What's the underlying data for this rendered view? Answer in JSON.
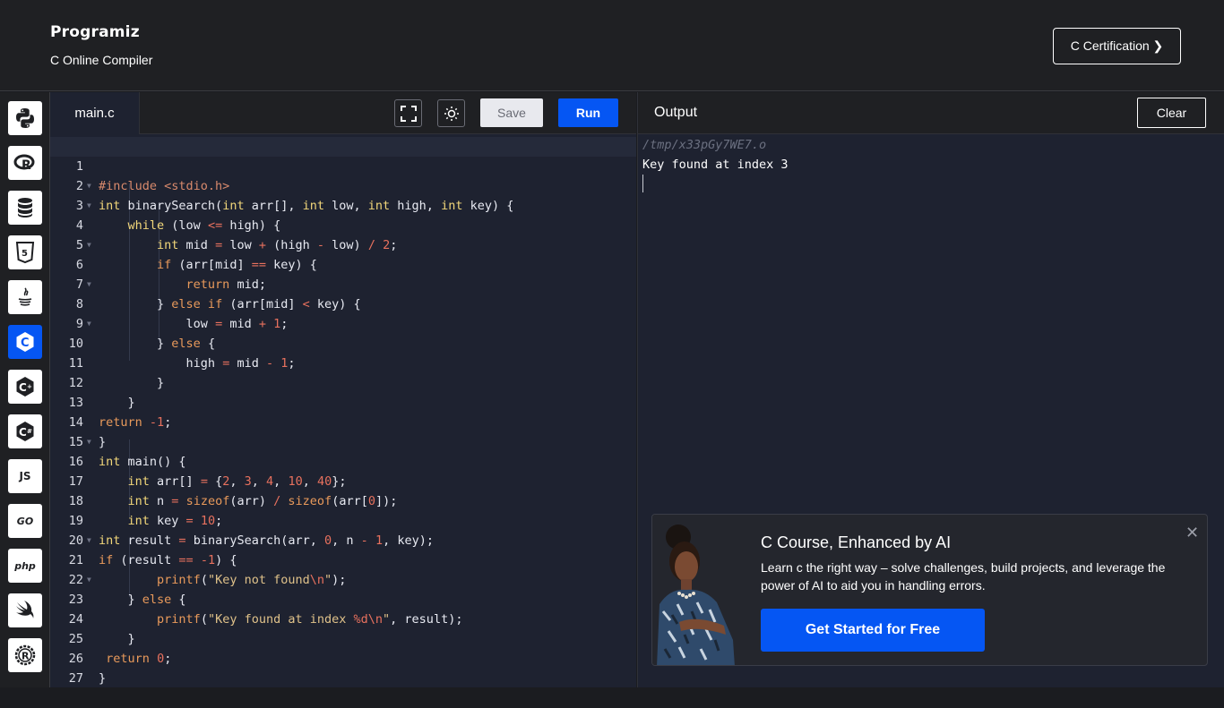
{
  "header": {
    "logo_text": "Programiz",
    "subtitle": "C Online Compiler",
    "cert_button": "C Certification ❯"
  },
  "sidebar": {
    "items": [
      {
        "name": "python",
        "label": ""
      },
      {
        "name": "r",
        "label": "R"
      },
      {
        "name": "sql",
        "label": ""
      },
      {
        "name": "html",
        "label": "5"
      },
      {
        "name": "java",
        "label": ""
      },
      {
        "name": "c",
        "label": "C",
        "active": true
      },
      {
        "name": "cpp",
        "label": "C"
      },
      {
        "name": "csharp",
        "label": "C"
      },
      {
        "name": "js",
        "label": "JS"
      },
      {
        "name": "go",
        "label": "GO"
      },
      {
        "name": "php",
        "label": "php"
      },
      {
        "name": "swift",
        "label": ""
      },
      {
        "name": "rust",
        "label": "R"
      }
    ]
  },
  "editor": {
    "file_tab": "main.c",
    "save_label": "Save",
    "run_label": "Run",
    "lines": [
      {
        "n": "1",
        "fold": false
      },
      {
        "n": "2",
        "fold": true
      },
      {
        "n": "3",
        "fold": true
      },
      {
        "n": "4",
        "fold": false
      },
      {
        "n": "5",
        "fold": true
      },
      {
        "n": "6",
        "fold": false
      },
      {
        "n": "7",
        "fold": true
      },
      {
        "n": "8",
        "fold": false
      },
      {
        "n": "9",
        "fold": true
      },
      {
        "n": "10",
        "fold": false
      },
      {
        "n": "11",
        "fold": false
      },
      {
        "n": "12",
        "fold": false
      },
      {
        "n": "13",
        "fold": false
      },
      {
        "n": "14",
        "fold": false
      },
      {
        "n": "15",
        "fold": true
      },
      {
        "n": "16",
        "fold": false
      },
      {
        "n": "17",
        "fold": false
      },
      {
        "n": "18",
        "fold": false
      },
      {
        "n": "19",
        "fold": false
      },
      {
        "n": "20",
        "fold": true
      },
      {
        "n": "21",
        "fold": false
      },
      {
        "n": "22",
        "fold": true
      },
      {
        "n": "23",
        "fold": false
      },
      {
        "n": "24",
        "fold": false
      },
      {
        "n": "25",
        "fold": false
      },
      {
        "n": "26",
        "fold": false
      },
      {
        "n": "27",
        "fold": false
      }
    ],
    "code": {
      "l1_a": "#include ",
      "l1_b": "<stdio.h>",
      "l2_a": "int",
      "l2_b": " binarySearch(",
      "l2_c": "int",
      "l2_d": " arr[], ",
      "l2_e": "int",
      "l2_f": " low, ",
      "l2_g": "int",
      "l2_h": " high, ",
      "l2_i": "int",
      "l2_j": " key) {",
      "l3_a": "while",
      "l3_b": " (low ",
      "l3_c": "<=",
      "l3_d": " high) {",
      "l4_a": "int",
      "l4_b": " mid ",
      "l4_c": "=",
      "l4_d": " low ",
      "l4_e": "+",
      "l4_f": " (high ",
      "l4_g": "-",
      "l4_h": " low) ",
      "l4_i": "/",
      "l4_j": " ",
      "l4_k": "2",
      "l4_l": ";",
      "l5_a": "if",
      "l5_b": " (arr[mid] ",
      "l5_c": "==",
      "l5_d": " key) {",
      "l6_a": "return",
      "l6_b": " mid;",
      "l7_a": "} ",
      "l7_b": "else if",
      "l7_c": " (arr[mid] ",
      "l7_d": "<",
      "l7_e": " key) {",
      "l8_a": "low ",
      "l8_b": "=",
      "l8_c": " mid ",
      "l8_d": "+",
      "l8_e": " ",
      "l8_f": "1",
      "l8_g": ";",
      "l9_a": "} ",
      "l9_b": "else",
      "l9_c": " {",
      "l10_a": "high ",
      "l10_b": "=",
      "l10_c": " mid ",
      "l10_d": "-",
      "l10_e": " ",
      "l10_f": "1",
      "l10_g": ";",
      "l11": "}",
      "l12": "}",
      "l13_a": "return",
      "l13_b": " ",
      "l13_c": "-1",
      "l13_d": ";",
      "l14": "}",
      "l15_a": "int",
      "l15_b": " main() {",
      "l16_a": "int",
      "l16_b": " arr[] ",
      "l16_c": "=",
      "l16_d": " {",
      "l16_e": "2",
      "l16_f": ", ",
      "l16_g": "3",
      "l16_h": ", ",
      "l16_i": "4",
      "l16_j": ", ",
      "l16_k": "10",
      "l16_l": ", ",
      "l16_m": "40",
      "l16_n": "};",
      "l17_a": "int",
      "l17_b": " n ",
      "l17_c": "=",
      "l17_d": " ",
      "l17_e": "sizeof",
      "l17_f": "(arr) ",
      "l17_g": "/",
      "l17_h": " ",
      "l17_i": "sizeof",
      "l17_j": "(arr[",
      "l17_k": "0",
      "l17_l": "]);",
      "l18_a": "int",
      "l18_b": " key ",
      "l18_c": "=",
      "l18_d": " ",
      "l18_e": "10",
      "l18_f": ";",
      "l19_a": "int",
      "l19_b": " result ",
      "l19_c": "=",
      "l19_d": " binarySearch(arr, ",
      "l19_e": "0",
      "l19_f": ", n ",
      "l19_g": "-",
      "l19_h": " ",
      "l19_i": "1",
      "l19_j": ", key);",
      "l20_a": "if",
      "l20_b": " (result ",
      "l20_c": "==",
      "l20_d": " ",
      "l20_e": "-1",
      "l20_f": ") {",
      "l21_a": "printf",
      "l21_b": "(",
      "l21_c": "\"Key not found",
      "l21_d": "\\n",
      "l21_e": "\"",
      "l21_f": ");",
      "l22_a": "} ",
      "l22_b": "else",
      "l22_c": " {",
      "l23_a": "printf",
      "l23_b": "(",
      "l23_c": "\"Key found at index ",
      "l23_d": "%d\\n",
      "l23_e": "\"",
      "l23_f": ", result);",
      "l24": "}",
      "l25_a": "return",
      "l25_b": " ",
      "l25_c": "0",
      "l25_d": ";",
      "l26": "}"
    }
  },
  "output": {
    "title": "Output",
    "clear_label": "Clear",
    "path": "/tmp/x33pGy7WE7.o",
    "result": "Key found at index 3"
  },
  "ad": {
    "title": "C Course, Enhanced by AI",
    "description": "Learn c the right way – solve challenges, build projects, and leverage the power of AI to aid you in handling errors.",
    "cta": "Get Started for Free",
    "close": "✕"
  },
  "colors": {
    "accent": "#0556f3",
    "editor_bg": "#1e2230",
    "header_bg": "#1f2023"
  }
}
